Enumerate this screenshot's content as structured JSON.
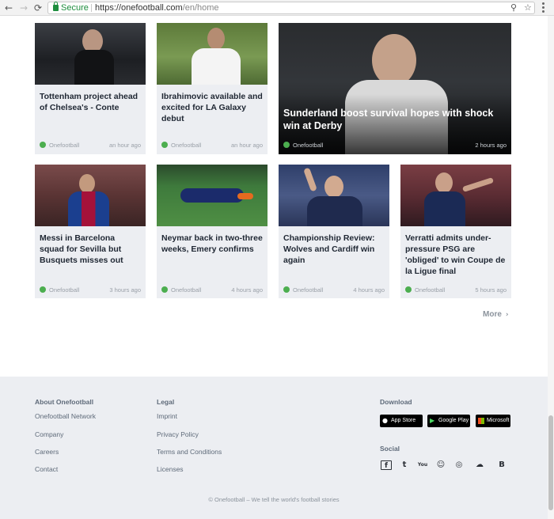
{
  "browser": {
    "back_icon": "←",
    "forward_icon": "→",
    "reload_icon": "⟳",
    "secure_label": "Secure",
    "url_host": "https://onefootball.com",
    "url_path": "/en/home",
    "zoom_icon": "⚲",
    "star_icon": "☆"
  },
  "cards": [
    {
      "title": "Tottenham project ahead of Chelsea's - Conte",
      "source": "Onefootball",
      "time": "an hour ago"
    },
    {
      "title": "Ibrahimovic available and excited for LA Galaxy debut",
      "source": "Onefootball",
      "time": "an hour ago"
    },
    {
      "title": "Sunderland boost survival hopes with shock win at Derby",
      "source": "Onefootball",
      "time": "2 hours ago"
    },
    {
      "title": "Messi in Barcelona squad for Sevilla but Busquets misses out",
      "source": "Onefootball",
      "time": "3 hours ago"
    },
    {
      "title": "Neymar back in two-three weeks, Emery confirms",
      "source": "Onefootball",
      "time": "4 hours ago"
    },
    {
      "title": "Championship Review: Wolves and Cardiff win again",
      "source": "Onefootball",
      "time": "4 hours ago"
    },
    {
      "title": "Verratti admits under-pressure PSG are 'obliged' to win Coupe de la Ligue final",
      "source": "Onefootball",
      "time": "5 hours ago"
    }
  ],
  "more_label": "More",
  "more_chevron": "›",
  "footer": {
    "about_heading": "About Onefootball",
    "about_links": [
      "Onefootball Network",
      "Company",
      "Careers",
      "Contact"
    ],
    "legal_heading": "Legal",
    "legal_links": [
      "Imprint",
      "Privacy Policy",
      "Terms and Conditions",
      "Licenses"
    ],
    "download_heading": "Download",
    "stores": [
      "App Store",
      "Google Play",
      "Microsoft"
    ],
    "social_heading": "Social",
    "social_icons": [
      "f",
      "t",
      "You",
      "☺",
      "◎",
      "☁",
      "B"
    ],
    "copyright": "© Onefootball – We tell the world's football stories"
  },
  "colors": {
    "accent_green": "#4cae4f",
    "card_bg": "#eceef2",
    "title_text": "#1f2733"
  }
}
